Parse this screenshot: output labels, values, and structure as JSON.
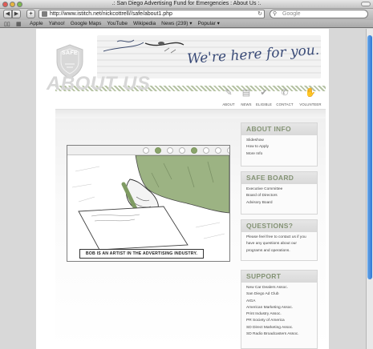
{
  "browser": {
    "window_title": ".: San Diego Advertising Fund for Emergencies : About Us :.",
    "url": "http://www.istitch.net/nickcottrell//safe/about1.php",
    "search_placeholder": "Google",
    "back_glyph": "◀",
    "forward_glyph": "▶",
    "add_glyph": "+",
    "reload_glyph": "↻",
    "bookmarks": [
      "Apple",
      "Yahoo!",
      "Google Maps",
      "YouTube",
      "Wikipedia",
      "News (239) ▾",
      "Popular ▾"
    ]
  },
  "site": {
    "logo_text": "SAFE",
    "banner_text": "We're here for you...",
    "nav": [
      {
        "label": "ABOUT",
        "icon": "about-icon",
        "glyph": "✎"
      },
      {
        "label": "NEWS",
        "icon": "news-icon",
        "glyph": "▤"
      },
      {
        "label": "ELIGIBLE",
        "icon": "eligible-icon",
        "glyph": "✔"
      },
      {
        "label": "CONTACT",
        "icon": "contact-icon",
        "glyph": "✆"
      },
      {
        "label": "VOLUNTEER",
        "icon": "volunteer-icon",
        "glyph": "✋"
      }
    ],
    "page_title": "ABOUT US",
    "slideshow": {
      "total_slides": 8,
      "active_slides": [
        1,
        4
      ],
      "caption": "BOB IS AN ARTIST IN THE ADVERTISING INDUSTRY."
    },
    "sidebar": {
      "about": {
        "title": "ABOUT INFO",
        "links": [
          "Slideshow",
          "How to Apply",
          "More Info"
        ]
      },
      "board": {
        "title": "SAFE BOARD",
        "links": [
          "Executive Committee",
          "Board of Directors",
          "Advisory Board"
        ]
      },
      "questions": {
        "title": "QUESTIONS?",
        "text": "Please feel free to contact us if you have any questions about our programs and operations."
      },
      "support": {
        "title": "SUPPORT",
        "links": [
          "New Car Dealers Assoc.",
          "San Diego Ad Club",
          "AIGA",
          "American Marketing Assoc.",
          "Print Industry Assoc.",
          "PR Society of America",
          "SD Direct Marketing Assoc.",
          "SD Radio Broadcasters Assoc."
        ]
      }
    }
  },
  "colors": {
    "accent_green": "#849375",
    "active_dot": "#8ba56c",
    "scroll_thumb": "#2f78d6"
  }
}
